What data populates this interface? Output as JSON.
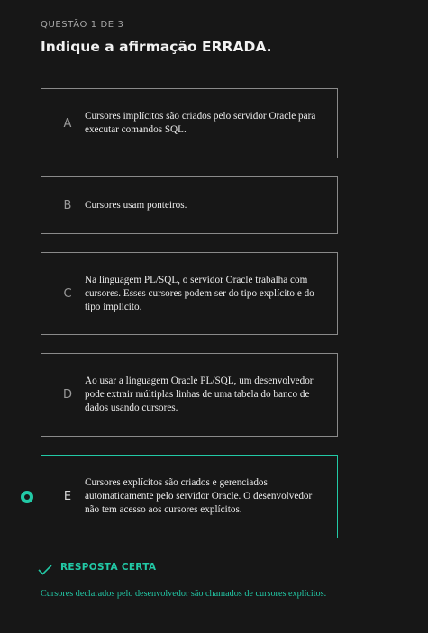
{
  "question": {
    "counter": "QUESTÃO 1 DE 3",
    "prompt": "Indique a afirmação ERRADA."
  },
  "options": [
    {
      "letter": "A",
      "text": "Cursores implícitos são criados pelo servidor Oracle para executar comandos SQL."
    },
    {
      "letter": "B",
      "text": "Cursores usam ponteiros."
    },
    {
      "letter": "C",
      "text": "Na linguagem PL/SQL, o servidor Oracle trabalha com cursores. Esses cursores podem ser do tipo explícito e do tipo implícito."
    },
    {
      "letter": "D",
      "text": "Ao usar a linguagem Oracle PL/SQL, um desenvolvedor pode extrair múltiplas linhas de uma tabela do banco de dados usando cursores."
    },
    {
      "letter": "E",
      "text": "Cursores explícitos são criados e gerenciados automaticamente pelo servidor Oracle. O desenvolvedor não tem acesso aos cursores explícitos."
    }
  ],
  "selected_option": "E",
  "feedback": {
    "label": "RESPOSTA CERTA",
    "explanation": "Cursores declarados pelo desenvolvedor são chamados de cursores explícitos."
  },
  "colors": {
    "accent": "#22c9a6",
    "background": "#171717",
    "border": "#8a8a8a"
  },
  "icons": {
    "selected_marker": "radio-selected-icon",
    "feedback": "check-icon"
  }
}
